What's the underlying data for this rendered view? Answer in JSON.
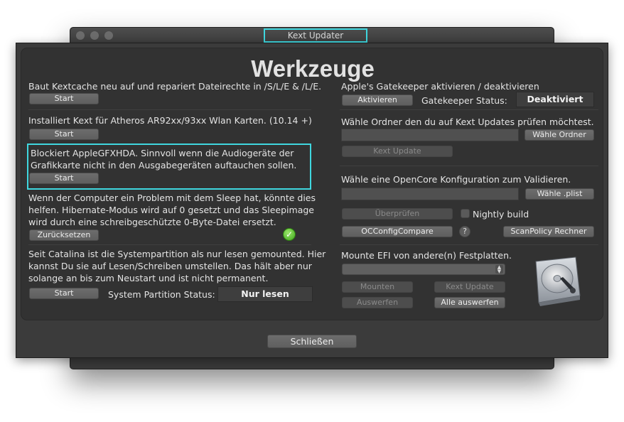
{
  "window": {
    "title": "Kext Updater"
  },
  "heading": "Werkzeuge",
  "left": {
    "kextcache": {
      "text": "Baut Kextcache neu auf und repariert Dateirechte in /S/L/E & /L/E.",
      "button": "Start"
    },
    "atheros": {
      "text": "Installiert Kext für Atheros AR92xx/93xx Wlan Karten. (10.14 +)",
      "button": "Start"
    },
    "gfxhda": {
      "text_line1": "Blockiert AppleGFXHDA. Sinnvoll wenn die Audiogeräte der",
      "text_line2": "Grafikkarte nicht in den Ausgabegeräten auftauchen sollen.",
      "button": "Start"
    },
    "sleep": {
      "text_line1": "Wenn der Computer ein Problem mit dem Sleep hat, könnte dies",
      "text_line2": "helfen. Hibernate-Modus wird auf 0 gesetzt und das Sleepimage",
      "text_line3": "wird durch eine schreibgeschützte 0-Byte-Datei ersetzt.",
      "button": "Zurücksetzen"
    },
    "catalina": {
      "text_line1": "Seit Catalina ist die Systempartition als nur lesen gemounted. Hier",
      "text_line2": "kannst Du sie auf Lesen/Schreiben umstellen. Das hält aber nur",
      "text_line3": "solange an bis zum Neustart und ist nicht permanent.",
      "button": "Start",
      "status_label": "System Partition Status:",
      "status_value": "Nur lesen"
    }
  },
  "right": {
    "gatekeeper": {
      "title": "Apple's Gatekeeper aktivieren / deaktivieren",
      "button": "Aktivieren",
      "status_label": "Gatekeeper Status:",
      "status_value": "Deaktiviert"
    },
    "kext_folder": {
      "title": "Wähle Ordner den du auf Kext Updates prüfen möchtest.",
      "path_value": "",
      "choose_button": "Wähle Ordner",
      "update_button": "Kext Update"
    },
    "opencore": {
      "title": "Wähle eine OpenCore Konfiguration zum Validieren.",
      "path_value": "",
      "choose_button": "Wähle .plist",
      "check_button": "Überprüfen",
      "nightly_label": "Nightly build",
      "compare_button": "OCConfigCompare",
      "help": "?",
      "scanpolicy_button": "ScanPolicy Rechner"
    },
    "efi": {
      "title": "Mounte EFI von andere(n) Festplatten.",
      "dropdown_value": "",
      "mount_button": "Mounten",
      "kext_update_button": "Kext Update",
      "eject_button": "Auswerfen",
      "eject_all_button": "Alle auswerfen"
    }
  },
  "footer": {
    "close_button": "Schließen"
  },
  "colors": {
    "highlight": "#3fd7df",
    "background": "#323232"
  },
  "icons": {
    "check": "check-circle-icon",
    "drive": "hard-drive-icon"
  }
}
